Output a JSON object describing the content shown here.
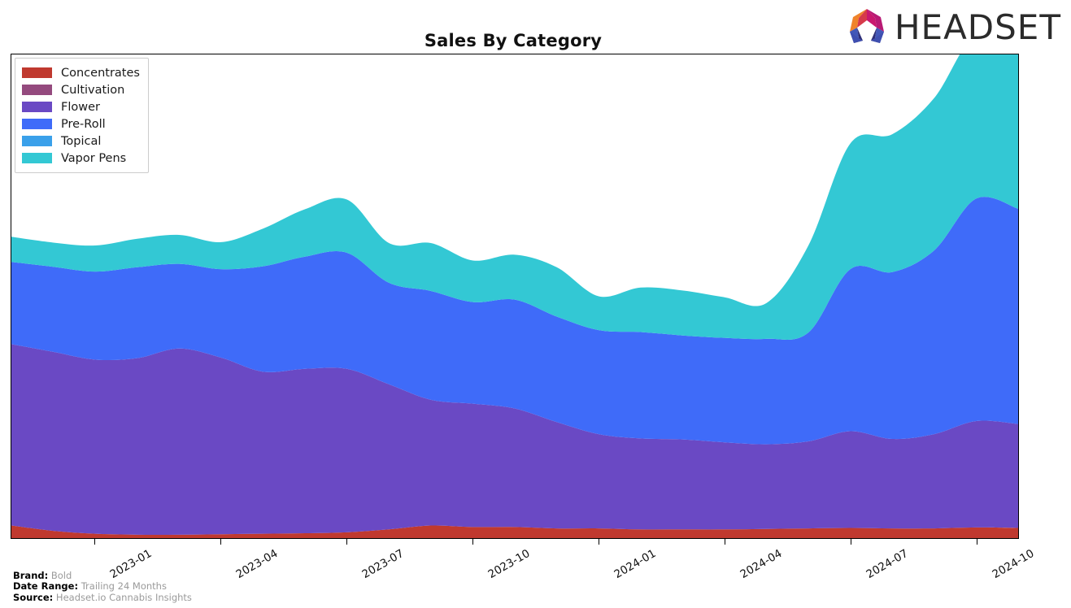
{
  "header": {
    "title": "Sales By Category",
    "logo_text": "HEADSET",
    "logo_icon": "headset-hexagon-logo"
  },
  "legend": {
    "position": "top-left",
    "items": [
      {
        "label": "Concentrates",
        "color": "#c0392f"
      },
      {
        "label": "Cultivation",
        "color": "#944a7e"
      },
      {
        "label": "Flower",
        "color": "#6a49c4"
      },
      {
        "label": "Pre-Roll",
        "color": "#3f6bf9"
      },
      {
        "label": "Topical",
        "color": "#3aa0ea"
      },
      {
        "label": "Vapor Pens",
        "color": "#33c8d4"
      }
    ]
  },
  "footer": {
    "brand_key": "Brand:",
    "brand_value": "Bold",
    "date_range_key": "Date Range:",
    "date_range_value": "Trailing 24 Months",
    "source_key": "Source:",
    "source_value": "Headset.io Cannabis Insights"
  },
  "chart_data": {
    "type": "area",
    "stacked": true,
    "smoothing": "spline",
    "title": "Sales By Category",
    "xlabel": "",
    "ylabel": "",
    "grid": false,
    "legend_position": "top-left",
    "x": [
      "2022-11",
      "2022-12",
      "2023-01",
      "2023-02",
      "2023-03",
      "2023-04",
      "2023-05",
      "2023-06",
      "2023-07",
      "2023-08",
      "2023-09",
      "2023-10",
      "2023-11",
      "2023-12",
      "2024-01",
      "2024-02",
      "2024-03",
      "2024-04",
      "2024-05",
      "2024-06",
      "2024-07",
      "2024-08",
      "2024-09",
      "2024-10",
      "2024-11"
    ],
    "tick_labels": [
      "2023-01",
      "2023-04",
      "2023-07",
      "2023-10",
      "2024-01",
      "2024-04",
      "2024-07",
      "2024-10"
    ],
    "tick_x": [
      "2023-01",
      "2023-04",
      "2023-07",
      "2023-10",
      "2024-01",
      "2024-04",
      "2024-07",
      "2024-10"
    ],
    "ylim": [
      0,
      100
    ],
    "series": [
      {
        "name": "Concentrates",
        "color": "#c0392f",
        "values": [
          2.6,
          1.5,
          0.9,
          0.7,
          0.7,
          0.8,
          0.9,
          1.0,
          1.2,
          1.8,
          2.6,
          2.3,
          2.3,
          2.0,
          2.0,
          1.8,
          1.8,
          1.8,
          1.9,
          2.0,
          2.1,
          2.0,
          2.0,
          2.2,
          2.1
        ]
      },
      {
        "name": "Cultivation",
        "color": "#944a7e",
        "values": [
          0,
          0,
          0,
          0,
          0,
          0,
          0,
          0,
          0,
          0,
          0,
          0,
          0,
          0,
          0,
          0,
          0,
          0,
          0,
          0,
          0,
          0,
          0,
          0,
          0
        ]
      },
      {
        "name": "Flower",
        "color": "#6a49c4",
        "values": [
          37.5,
          37.0,
          36.0,
          36.5,
          38.5,
          36.5,
          33.5,
          34.0,
          33.8,
          30.0,
          26.0,
          25.5,
          24.5,
          22.0,
          19.5,
          18.8,
          18.6,
          18.0,
          17.5,
          18.0,
          20.0,
          18.5,
          19.5,
          22.0,
          21.5
        ]
      },
      {
        "name": "Pre-Roll",
        "color": "#3f6bf9",
        "values": [
          17.0,
          17.6,
          18.2,
          18.8,
          17.5,
          18.3,
          21.8,
          23.2,
          24.0,
          21.0,
          22.5,
          21.0,
          22.5,
          21.8,
          21.5,
          22.0,
          21.5,
          21.6,
          21.8,
          22.5,
          33.5,
          34.5,
          38.0,
          46.0,
          44.5
        ]
      },
      {
        "name": "Topical",
        "color": "#3aa0ea",
        "values": [
          0,
          0,
          0,
          0,
          0,
          0,
          0,
          0,
          0,
          0,
          0,
          0,
          0,
          0,
          0,
          0,
          0,
          0,
          0,
          0,
          0,
          0,
          0,
          0,
          0
        ]
      },
      {
        "name": "Vapor Pens",
        "color": "#33c8d4",
        "values": [
          5.2,
          5.0,
          5.4,
          5.9,
          6.0,
          5.6,
          7.8,
          9.8,
          11.0,
          8.2,
          9.9,
          8.6,
          9.3,
          10.2,
          7.0,
          9.2,
          9.3,
          8.4,
          7.4,
          18.0,
          26.0,
          28.5,
          31.5,
          34.0,
          32.0
        ]
      }
    ]
  }
}
